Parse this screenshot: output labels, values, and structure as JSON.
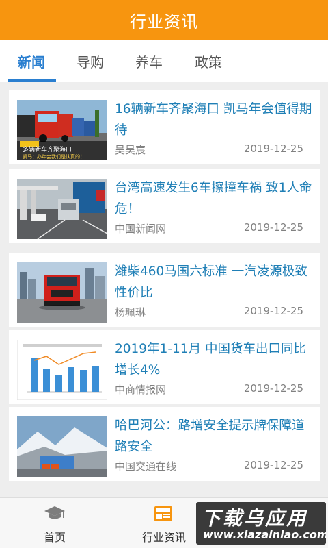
{
  "header": {
    "title": "行业资讯"
  },
  "tabs": [
    {
      "label": "新闻",
      "active": true
    },
    {
      "label": "导购",
      "active": false
    },
    {
      "label": "养车",
      "active": false
    },
    {
      "label": "政策",
      "active": false
    }
  ],
  "articles": [
    {
      "title": "16辆新车齐聚海口 凯马年会值得期待",
      "source": "吴昊宸",
      "date": "2019-12-25",
      "image": "trucks-photo",
      "caption": "多辆新车齐聚海口",
      "caption2": "凯马：办年会我们是认真的！"
    },
    {
      "title": "台湾高速发生6车擦撞车祸 致1人命危！",
      "source": "中国新闻网",
      "date": "2019-12-25",
      "image": "accident-photo"
    },
    {
      "title": "潍柴460马国六标准 一汽凌源极致性价比",
      "source": "杨珮琳",
      "date": "2019-12-25",
      "image": "red-truck-photo"
    },
    {
      "title": "2019年1-11月 中国货车出口同比增长4%",
      "source": "中商情报网",
      "date": "2019-12-25",
      "image": "bar-chart-photo"
    },
    {
      "title": "哈巴河公：路增安全提示牌保障道路安全",
      "source": "中国交通在线",
      "date": "2019-12-25",
      "image": "snow-mountain-photo"
    }
  ],
  "bottom_nav": [
    {
      "label": "首页",
      "icon": "graduation-cap-icon"
    },
    {
      "label": "行业资讯",
      "icon": "news-icon"
    }
  ],
  "watermark": {
    "line1": "下载乌应用",
    "line2": "www.xiazainiao.com"
  },
  "colors": {
    "header": "#f7950f",
    "accent": "#2a7fd0",
    "title_text": "#1f7fb6"
  }
}
